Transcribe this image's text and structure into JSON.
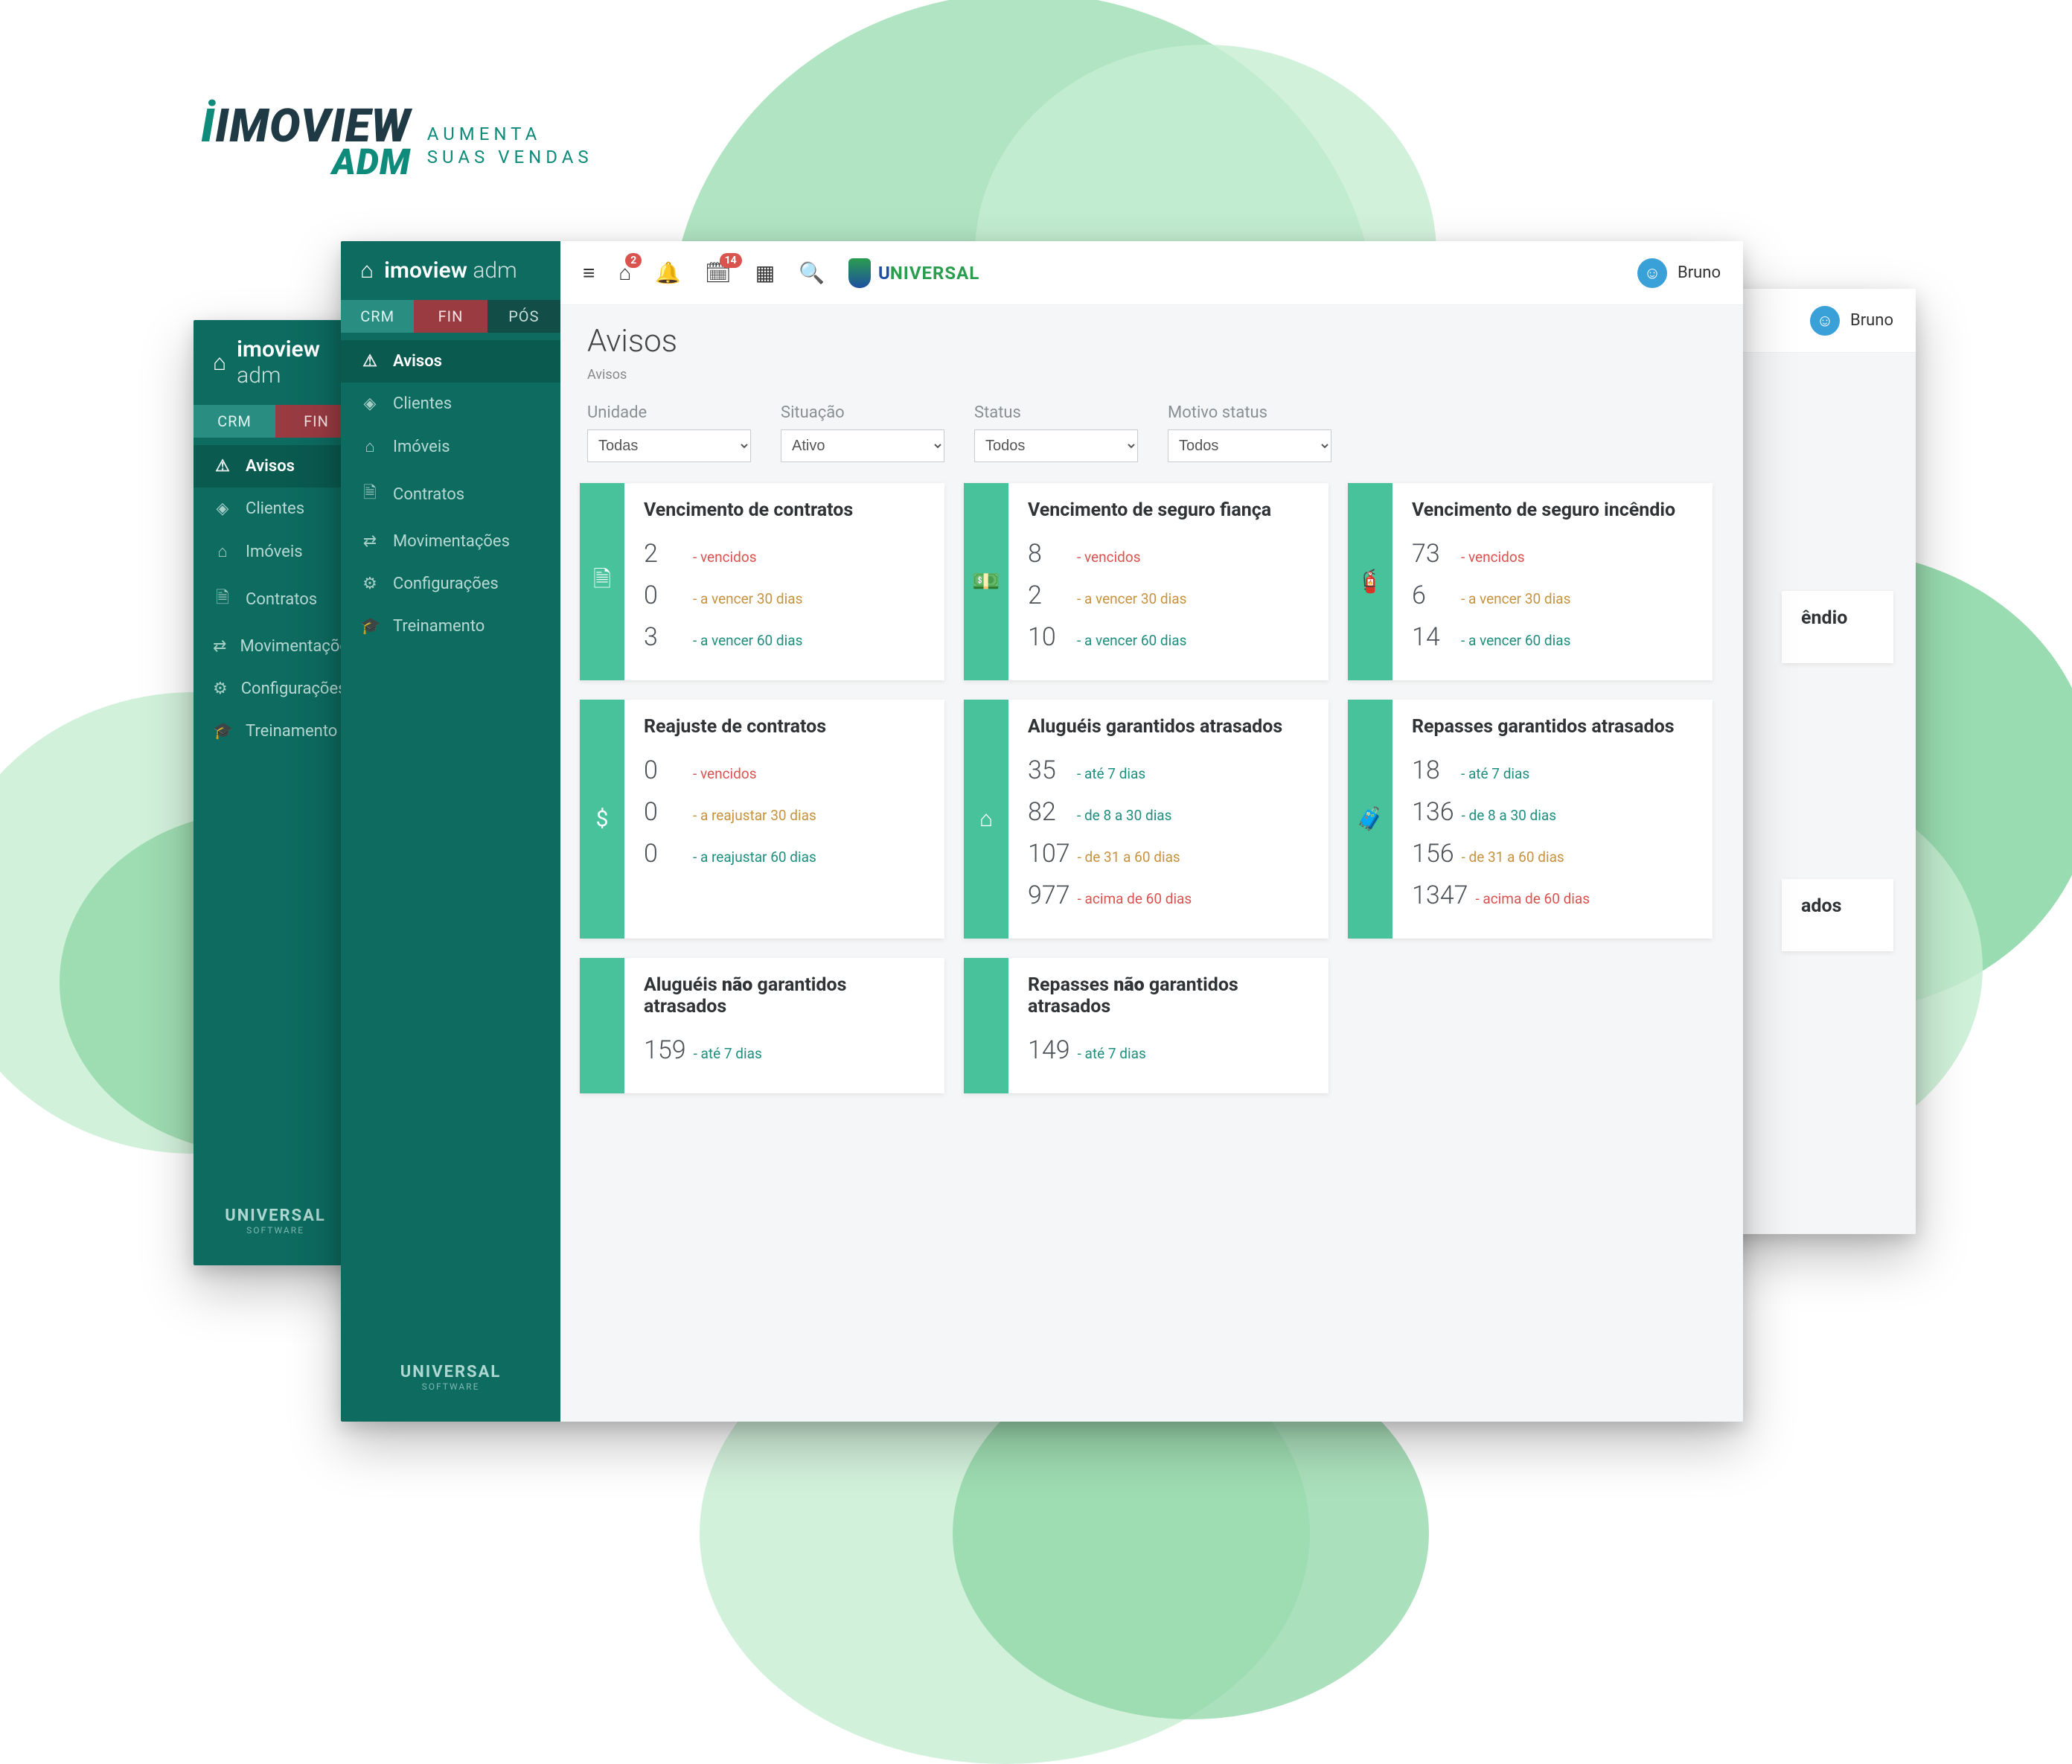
{
  "brand": {
    "logo_line1": "IMOVIEW",
    "logo_line2": "ADM",
    "tag_1": "AUMENTA",
    "tag_2": "SUAS VENDAS"
  },
  "app": {
    "title_strong": "imoview",
    "title_thin": "adm",
    "tabs": {
      "crm": "CRM",
      "fin": "FIN",
      "pos": "PÓS"
    },
    "menu": [
      {
        "icon": "⚠",
        "label": "Avisos",
        "active": true
      },
      {
        "icon": "◈",
        "label": "Clientes",
        "active": false
      },
      {
        "icon": "⌂",
        "label": "Imóveis",
        "active": false
      },
      {
        "icon": "🗎",
        "label": "Contratos",
        "active": false
      },
      {
        "icon": "⇄",
        "label": "Movimentações",
        "active": false
      },
      {
        "icon": "⚙",
        "label": "Configurações",
        "active": false
      },
      {
        "icon": "🎓",
        "label": "Treinamento",
        "active": false
      }
    ],
    "footer_brand": "UNIVERSAL",
    "footer_sub": "SOFTWARE"
  },
  "topbar": {
    "badge_home": "2",
    "badge_cal": "14",
    "uni_u": "U",
    "uni_rest": "NIVERSAL",
    "user": "Bruno"
  },
  "page": {
    "title": "Avisos",
    "crumb": "Avisos"
  },
  "filters": {
    "unidade": {
      "label": "Unidade",
      "value": "Todas"
    },
    "situacao": {
      "label": "Situação",
      "value": "Ativo"
    },
    "status": {
      "label": "Status",
      "value": "Todos"
    },
    "motivo": {
      "label": "Motivo status",
      "value": "Todos"
    }
  },
  "cards": {
    "c1": {
      "icon": "🗎",
      "title": "Vencimento de contratos",
      "s1n": "2",
      "s1l": "- vencidos",
      "s2n": "0",
      "s2l": "- a vencer 30 dias",
      "s3n": "3",
      "s3l": "- a vencer 60 dias"
    },
    "c2": {
      "icon": "💵",
      "title": "Vencimento de seguro fiança",
      "s1n": "8",
      "s1l": "- vencidos",
      "s2n": "2",
      "s2l": "- a vencer 30 dias",
      "s3n": "10",
      "s3l": "- a vencer 60 dias"
    },
    "c3": {
      "icon": "🧯",
      "title": "Vencimento de seguro incêndio",
      "s1n": "73",
      "s1l": "- vencidos",
      "s2n": "6",
      "s2l": "- a vencer 30 dias",
      "s3n": "14",
      "s3l": "- a vencer 60 dias"
    },
    "c4": {
      "icon": "$",
      "title": "Reajuste de contratos",
      "s1n": "0",
      "s1l": "- vencidos",
      "s2n": "0",
      "s2l": "- a reajustar 30 dias",
      "s3n": "0",
      "s3l": "- a reajustar 60 dias"
    },
    "c5": {
      "icon": "⌂",
      "title": "Aluguéis garantidos atrasados",
      "s1n": "35",
      "s1l": "- até 7 dias",
      "s2n": "82",
      "s2l": "- de 8 a 30 dias",
      "s3n": "107",
      "s3l": "- de 31 a 60 dias",
      "s4n": "977",
      "s4l": "- acima de 60 dias"
    },
    "c6": {
      "icon": "🧳",
      "title": "Repasses garantidos atrasados",
      "s1n": "18",
      "s1l": "- até 7 dias",
      "s2n": "136",
      "s2l": "- de 8 a 30 dias",
      "s3n": "156",
      "s3l": "- de 31 a 60 dias",
      "s4n": "1347",
      "s4l": "- acima de 60 dias"
    },
    "c7": {
      "title_html": "Aluguéis não garantidos atrasados",
      "s1n": "159",
      "s1l": "- até 7 dias"
    },
    "c8": {
      "title_html": "Repasses não garantidos atrasados",
      "s1n": "149",
      "s1l": "- até 7 dias"
    }
  },
  "peek": {
    "card_right_1": "êndio",
    "card_right_2": "ados"
  }
}
